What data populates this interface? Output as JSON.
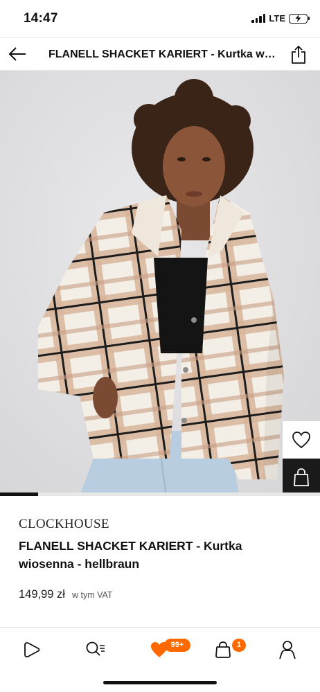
{
  "status_bar": {
    "time": "14:47",
    "network": "LTE"
  },
  "header": {
    "title": "FLANELL SHACKET KARIERT - Kurtka wiosenna - hellbraun",
    "back_icon": "arrow-left-icon",
    "share_icon": "share-icon"
  },
  "gallery": {
    "image_subject": "model-wearing-plaid-shacket",
    "progress_fraction": 0.12,
    "favorite_icon": "heart-icon",
    "bag_icon": "shopping-bag-icon"
  },
  "product": {
    "brand": "CLOCKHOUSE",
    "name": "FLANELL SHACKET KARIERT - Kurtka wiosenna - hellbraun",
    "price": "149,99 zł",
    "vat_note": "w tym VAT"
  },
  "tab_bar": {
    "items": [
      {
        "id": "home",
        "icon": "play-icon"
      },
      {
        "id": "search",
        "icon": "search-list-icon"
      },
      {
        "id": "wishlist",
        "icon": "heart-filled-icon",
        "badge": "99+"
      },
      {
        "id": "cart",
        "icon": "bag-icon",
        "badge": "1"
      },
      {
        "id": "account",
        "icon": "person-icon"
      }
    ]
  },
  "colors": {
    "accent": "#ff6900",
    "text": "#111111",
    "background": "#ffffff",
    "image_bg": "#dddddf",
    "dark_button": "#1a1a1a"
  }
}
